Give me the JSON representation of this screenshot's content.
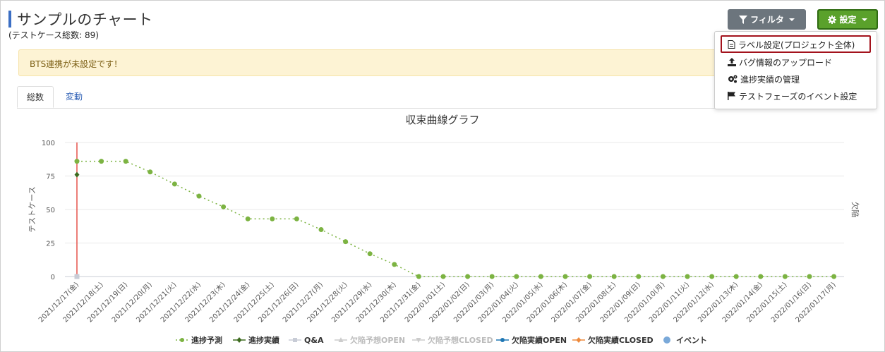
{
  "header": {
    "title": "サンプルのチャート",
    "subtitle": "(テストケース総数: 89)",
    "filter_label": "フィルタ",
    "settings_label": "設定"
  },
  "alert": {
    "text": "BTS連携が未設定です！"
  },
  "tabs": [
    {
      "label": "総数",
      "active": true
    },
    {
      "label": "変動",
      "active": false
    }
  ],
  "dropdown": {
    "items": [
      {
        "label": "ラベル設定(プロジェクト全体)",
        "icon": "file-icon",
        "highlighted": true
      },
      {
        "label": "バグ情報のアップロード",
        "icon": "upload-icon"
      },
      {
        "label": "進捗実績の管理",
        "icon": "gears-icon"
      },
      {
        "label": "テストフェーズのイベント設定",
        "icon": "flag-icon"
      }
    ]
  },
  "colors": {
    "accent": "#3c6fc4",
    "filter_button": "#6c757d",
    "settings_button": "#5aa12b",
    "alert_bg": "#fdf3d4",
    "highlight_border": "#a3121c",
    "forecast": "#7cb342",
    "actual": "#3d6b1f",
    "qa": "#c8ccd6",
    "event": "#e5534b"
  },
  "chart_data": {
    "type": "line",
    "title": "収束曲線グラフ",
    "ylabel": "テストケース",
    "y2label": "欠陥",
    "ylim": [
      0,
      100
    ],
    "yticks": [
      0,
      25,
      50,
      75,
      100
    ],
    "grid": true,
    "legend_position": "bottom",
    "categories": [
      "2021/12/17(金)",
      "2021/12/18(土)",
      "2021/12/19(日)",
      "2021/12/20(月)",
      "2021/12/21(火)",
      "2021/12/22(水)",
      "2021/12/23(木)",
      "2021/12/24(金)",
      "2021/12/25(土)",
      "2021/12/26(日)",
      "2021/12/27(月)",
      "2021/12/28(火)",
      "2021/12/29(水)",
      "2021/12/30(木)",
      "2021/12/31(金)",
      "2022/01/01(土)",
      "2022/01/02(日)",
      "2022/01/03(月)",
      "2022/01/04(火)",
      "2022/01/05(水)",
      "2022/01/06(木)",
      "2022/01/07(金)",
      "2022/01/08(土)",
      "2022/01/09(日)",
      "2022/01/10(月)",
      "2022/01/11(火)",
      "2022/01/12(水)",
      "2022/01/13(木)",
      "2022/01/14(金)",
      "2022/01/15(土)",
      "2022/01/16(日)",
      "2022/01/17(月)"
    ],
    "series": [
      {
        "name": "進捗予測",
        "values": [
          86,
          86,
          86,
          78,
          69,
          60,
          52,
          43,
          43,
          43,
          35,
          26,
          17,
          9,
          0,
          0,
          0,
          0,
          0,
          0,
          0,
          0,
          0,
          0,
          0,
          0,
          0,
          0,
          0,
          0,
          0,
          0
        ]
      },
      {
        "name": "進捗実績",
        "values": [
          76
        ]
      },
      {
        "name": "Q&A",
        "values": [
          0
        ]
      }
    ],
    "event_category": "2021/12/17(金)",
    "legend": [
      {
        "name": "進捗予測",
        "color": "#7cb342",
        "enabled": true
      },
      {
        "name": "進捗実績",
        "color": "#3d6b1f",
        "enabled": true
      },
      {
        "name": "Q&A",
        "color": "#c8ccd6",
        "enabled": true
      },
      {
        "name": "欠陥予想OPEN",
        "color": "#cccccc",
        "enabled": false
      },
      {
        "name": "欠陥予想CLOSED",
        "color": "#cccccc",
        "enabled": false
      },
      {
        "name": "欠陥実績OPEN",
        "color": "#1f77b4",
        "enabled": true
      },
      {
        "name": "欠陥実績CLOSED",
        "color": "#ee8a3c",
        "enabled": true
      },
      {
        "name": "イベント",
        "color": "#7aa9d9",
        "enabled": true
      }
    ]
  }
}
